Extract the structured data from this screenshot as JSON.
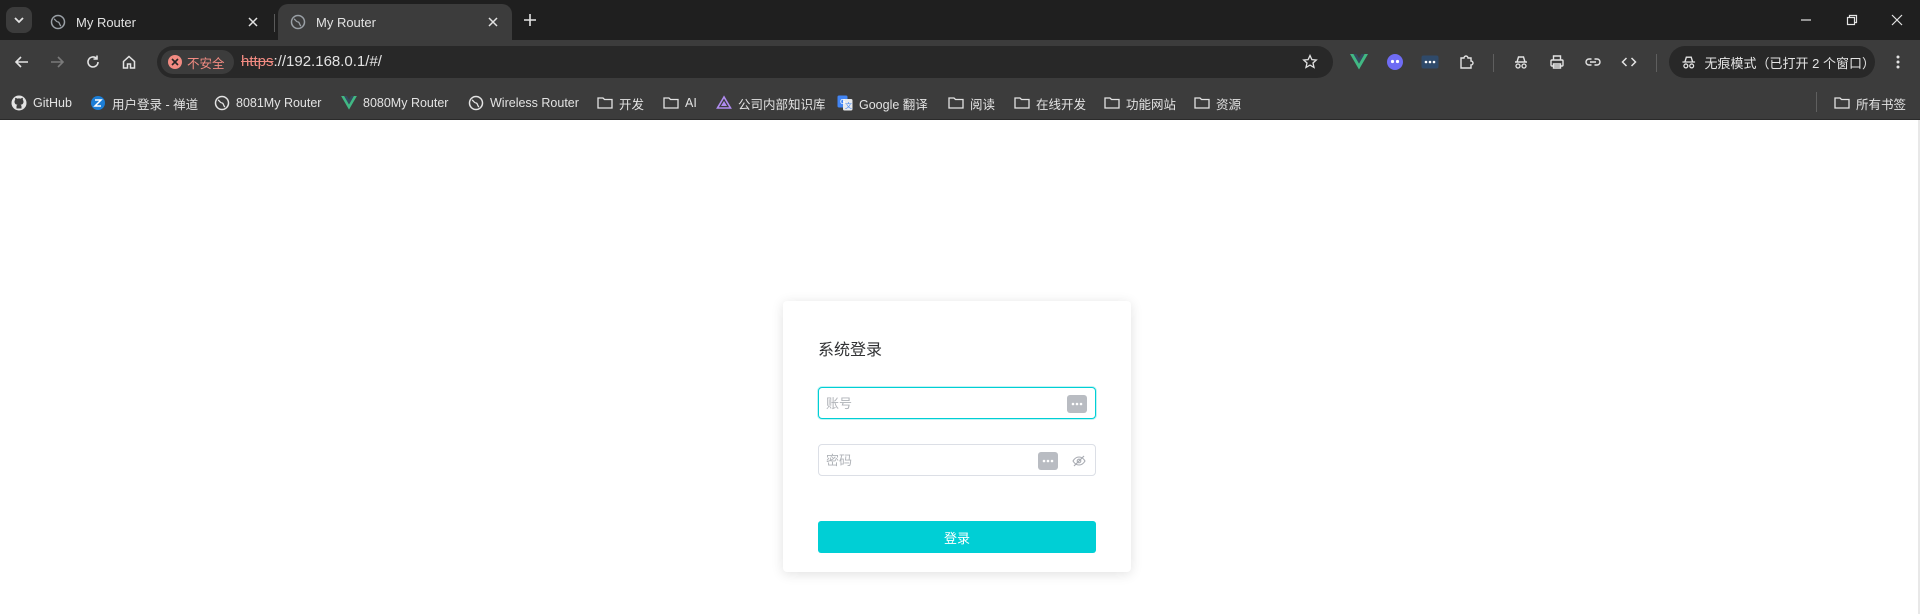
{
  "tabs": [
    {
      "title": "My Router",
      "active": false
    },
    {
      "title": "My Router",
      "active": true
    }
  ],
  "omnibox": {
    "security_label": "不安全",
    "url_scheme": "https",
    "url_rest": "://192.168.0.1/#/"
  },
  "incognito": {
    "label": "无痕模式（已打开 2 个窗口）"
  },
  "bookmarks": [
    {
      "label": "GitHub",
      "icon": "github-icon"
    },
    {
      "label": "用户登录 - 禅道",
      "icon": "zentao-icon"
    },
    {
      "label": "8081My Router",
      "icon": "globe-icon"
    },
    {
      "label": "8080My Router",
      "icon": "vue-icon"
    },
    {
      "label": "Wireless Router",
      "icon": "globe-icon"
    },
    {
      "label": "开发",
      "icon": "folder-icon"
    },
    {
      "label": "AI",
      "icon": "folder-icon"
    },
    {
      "label": "公司内部知识库",
      "icon": "kb-icon"
    },
    {
      "label": "Google 翻译",
      "icon": "translate-icon"
    },
    {
      "label": "阅读",
      "icon": "folder-icon"
    },
    {
      "label": "在线开发",
      "icon": "folder-icon"
    },
    {
      "label": "功能网站",
      "icon": "folder-icon"
    },
    {
      "label": "资源",
      "icon": "folder-icon"
    }
  ],
  "all_bookmarks_label": "所有书签",
  "login": {
    "title": "系统登录",
    "account_placeholder": "账号",
    "password_placeholder": "密码",
    "submit_label": "登录"
  },
  "colors": {
    "accent": "#00cfd5",
    "browser_dark": "#1f1f1f",
    "toolbar": "#3c3c3c",
    "insecure": "#f28b82"
  }
}
